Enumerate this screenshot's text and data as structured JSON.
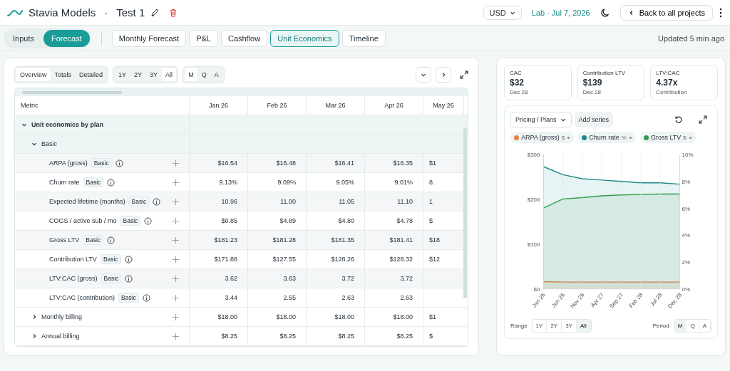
{
  "header": {
    "app_name": "Stavia Models",
    "separator": "·",
    "project": "Test 1",
    "currency": "USD",
    "environment": "Lab · Jul 7, 2026",
    "back_button": "Back to all projects"
  },
  "mode_tabs": [
    {
      "label": "Inputs",
      "selected": false
    },
    {
      "label": "Forecast",
      "selected": true
    }
  ],
  "tabs": [
    {
      "label": "Monthly Forecast",
      "selected": false
    },
    {
      "label": "P&L",
      "selected": false
    },
    {
      "label": "Cashflow",
      "selected": false
    },
    {
      "label": "Unit Economics",
      "selected": true
    },
    {
      "label": "Timeline",
      "selected": false
    }
  ],
  "updated": "Updated 5 min ago",
  "toolbar": {
    "views": [
      {
        "label": "Overview",
        "selected": true
      },
      {
        "label": "Totals",
        "selected": false
      },
      {
        "label": "Detailed",
        "selected": false
      }
    ],
    "ranges": [
      {
        "label": "1Y",
        "selected": false
      },
      {
        "label": "2Y",
        "selected": false
      },
      {
        "label": "3Y",
        "selected": false
      },
      {
        "label": "All",
        "selected": true
      }
    ],
    "periods": [
      {
        "label": "M",
        "selected": true
      },
      {
        "label": "Q",
        "selected": false
      },
      {
        "label": "A",
        "selected": false
      }
    ]
  },
  "table": {
    "columns": [
      "Metric",
      "Jan 26",
      "Feb 26",
      "Mar 26",
      "Apr 26",
      "May 26"
    ],
    "rows": [
      {
        "label": "Unit economics by plan",
        "expanded": true,
        "children": [
          {
            "label": "Basic",
            "expanded": true,
            "children": [
              {
                "label": "ARPA (gross)",
                "tag": "Basic",
                "values": [
                  "$16.54",
                  "$16.48",
                  "$16.41",
                  "$16.35",
                  "$1"
                ]
              },
              {
                "label": "Churn rate",
                "tag": "Basic",
                "values": [
                  "9.13%",
                  "9.09%",
                  "9.05%",
                  "9.01%",
                  "8."
                ]
              },
              {
                "label": "Expected lifetime (months)",
                "tag": "Basic",
                "values": [
                  "10.96",
                  "11.00",
                  "11.05",
                  "11.10",
                  "1"
                ]
              },
              {
                "label": "COGS / active sub / mo",
                "tag": "Basic",
                "values": [
                  "$0.85",
                  "$4.89",
                  "$4.80",
                  "$4.78",
                  "$"
                ]
              },
              {
                "label": "Gross LTV",
                "tag": "Basic",
                "values": [
                  "$181.23",
                  "$181.28",
                  "$181.35",
                  "$181.41",
                  "$18"
                ]
              },
              {
                "label": "Contribution LTV",
                "tag": "Basic",
                "values": [
                  "$171.88",
                  "$127.55",
                  "$128.26",
                  "$128.32",
                  "$12"
                ]
              },
              {
                "label": "LTV:CAC (gross)",
                "tag": "Basic",
                "values": [
                  "3.62",
                  "3.63",
                  "3.72",
                  "3.72"
                ]
              },
              {
                "label": "LTV:CAC (contribution)",
                "tag": "Basic",
                "values": [
                  "3.44",
                  "2.55",
                  "2.63",
                  "2.63"
                ]
              }
            ]
          },
          {
            "label": "Monthly billing",
            "expanded": false,
            "values": [
              "$18.00",
              "$18.00",
              "$18.00",
              "$18.00",
              "$1"
            ]
          },
          {
            "label": "Annual billing",
            "expanded": false,
            "values": [
              "$8.25",
              "$8.25",
              "$8.25",
              "$8.25",
              "$"
            ]
          }
        ]
      }
    ]
  },
  "kpis": [
    {
      "label": "CAC",
      "value": "$32",
      "note": "Dec 28"
    },
    {
      "label": "Contribution LTV",
      "value": "$139",
      "note": "Dec 28"
    },
    {
      "label": "LTV:CAC",
      "value": "4.37x",
      "note": "Contribution"
    }
  ],
  "chart_panel": {
    "dropdown": "Pricing / Plans",
    "add_button": "Add series",
    "chip_units": [
      "$",
      "%",
      "$"
    ],
    "chart_data": {
      "type": "area",
      "grid": true,
      "categories": [
        "Jan 26",
        "Jun 26",
        "Nov 26",
        "Apr 27",
        "Sep 27",
        "Feb 28",
        "Jul 28",
        "Dec 28"
      ],
      "ylim": [
        0,
        300
      ],
      "y2lim": [
        0,
        10
      ],
      "yticks": [
        {
          "value": 0,
          "label": "$0"
        },
        {
          "value": 100,
          "label": "$100"
        },
        {
          "value": 200,
          "label": "$200"
        },
        {
          "value": 300,
          "label": "$300"
        }
      ],
      "y2ticks": [
        {
          "value": 0,
          "label": "0%"
        },
        {
          "value": 2,
          "label": "2%"
        },
        {
          "value": 4,
          "label": "4%"
        },
        {
          "value": 6,
          "label": "6%"
        },
        {
          "value": 8,
          "label": "8%"
        },
        {
          "value": 10,
          "label": "10%"
        }
      ],
      "series": [
        {
          "name": "ARPA (gross)",
          "color": "#f07c4a",
          "values": [
            17,
            16,
            16,
            16,
            16,
            16,
            16,
            16
          ]
        },
        {
          "name": "Churn rate",
          "color": "#1a8a8a",
          "axis": "y2",
          "values": [
            9.1,
            8.5,
            8.2,
            8.1,
            8.0,
            7.9,
            7.9,
            7.8
          ]
        },
        {
          "name": "Gross LTV",
          "color": "#2e9e4a",
          "values": [
            181,
            201,
            204,
            208,
            210,
            211,
            212,
            212
          ]
        }
      ]
    },
    "range_label": "Range",
    "ranges": [
      {
        "label": "1Y",
        "selected": false
      },
      {
        "label": "2Y",
        "selected": false
      },
      {
        "label": "3Y",
        "selected": false
      },
      {
        "label": "All",
        "selected": true
      }
    ],
    "period_label": "Period",
    "periods": [
      {
        "label": "M",
        "selected": true
      },
      {
        "label": "Q",
        "selected": false
      },
      {
        "label": "A",
        "selected": false
      }
    ]
  }
}
